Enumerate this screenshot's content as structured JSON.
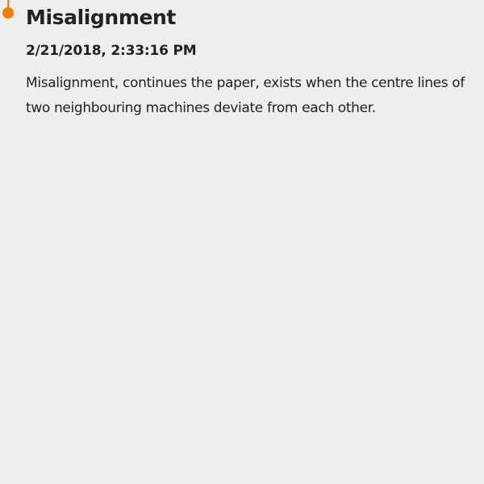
{
  "timeline": {
    "accent_color": "#f57c00"
  },
  "entry": {
    "title": "Misalignment",
    "timestamp": "2/21/2018, 2:33:16 PM",
    "body": "Misalignment, continues the paper, exists when the centre lines of two neighbouring machines deviate from each other."
  }
}
